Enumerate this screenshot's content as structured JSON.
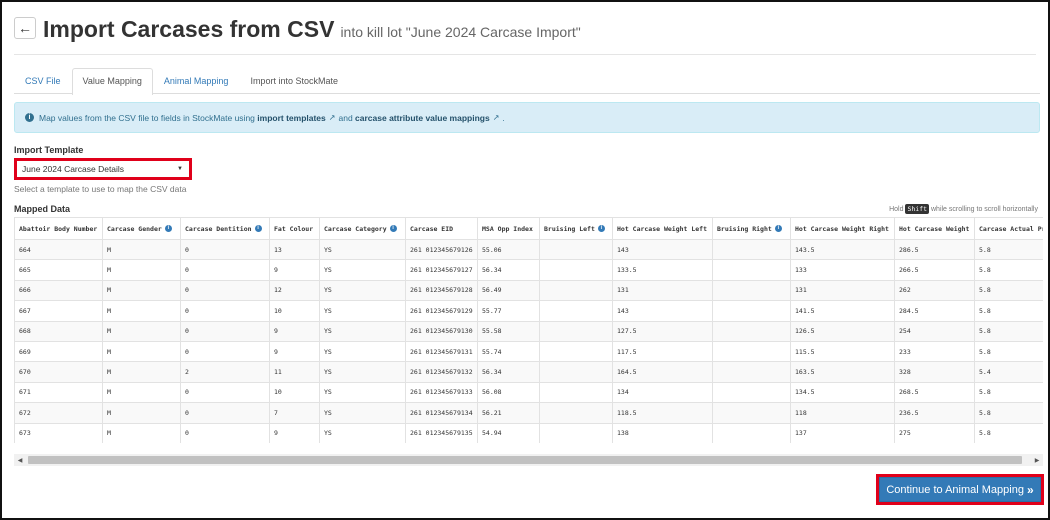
{
  "header": {
    "back_glyph": "←",
    "title": "Import Carcases from CSV",
    "subtitle": "into kill lot \"June 2024 Carcase Import\""
  },
  "tabs": [
    {
      "label": "CSV File",
      "state": "link"
    },
    {
      "label": "Value Mapping",
      "state": "active"
    },
    {
      "label": "Animal Mapping",
      "state": "link"
    },
    {
      "label": "Import into StockMate",
      "state": "plain"
    }
  ],
  "alert": {
    "prefix": "Map values from the CSV file to fields in StockMate using",
    "link1": "import templates",
    "middle": "and",
    "link2": "carcase attribute value mappings",
    "suffix": "."
  },
  "import_template": {
    "label": "Import Template",
    "selected": "June 2024 Carcase Details",
    "help": "Select a template to use to map the CSV data"
  },
  "mapped_data": {
    "label": "Mapped Data",
    "hint_prefix": "Hold",
    "hint_key": "Shift",
    "hint_suffix": "while scrolling to scroll horizontally"
  },
  "table": {
    "columns": [
      {
        "label": "Abattoir Body Number",
        "info": false
      },
      {
        "label": "Carcase Gender",
        "info": true
      },
      {
        "label": "Carcase Dentition",
        "info": true
      },
      {
        "label": "Fat Colour",
        "info": false
      },
      {
        "label": "Carcase Category",
        "info": true
      },
      {
        "label": "Carcase EID",
        "info": false
      },
      {
        "label": "MSA Opp Index",
        "info": false
      },
      {
        "label": "Bruising Left",
        "info": true
      },
      {
        "label": "Hot Carcase Weight Left",
        "info": false
      },
      {
        "label": "Bruising Right",
        "info": true
      },
      {
        "label": "Hot Carcase Weight Right",
        "info": false
      },
      {
        "label": "Hot Carcase Weight",
        "info": false
      },
      {
        "label": "Carcase Actual Pr",
        "info": false
      }
    ],
    "rows": [
      [
        "664",
        "M",
        "0",
        "13",
        "YS",
        "261 012345679126",
        "55.06",
        "",
        "143",
        "",
        "143.5",
        "286.5",
        "5.8"
      ],
      [
        "665",
        "M",
        "0",
        "9",
        "YS",
        "261 012345679127",
        "56.34",
        "",
        "133.5",
        "",
        "133",
        "266.5",
        "5.8"
      ],
      [
        "666",
        "M",
        "0",
        "12",
        "YS",
        "261 012345679128",
        "56.49",
        "",
        "131",
        "",
        "131",
        "262",
        "5.8"
      ],
      [
        "667",
        "M",
        "0",
        "10",
        "YS",
        "261 012345679129",
        "55.77",
        "",
        "143",
        "",
        "141.5",
        "284.5",
        "5.8"
      ],
      [
        "668",
        "M",
        "0",
        "9",
        "YS",
        "261 012345679130",
        "55.58",
        "",
        "127.5",
        "",
        "126.5",
        "254",
        "5.8"
      ],
      [
        "669",
        "M",
        "0",
        "9",
        "YS",
        "261 012345679131",
        "55.74",
        "",
        "117.5",
        "",
        "115.5",
        "233",
        "5.8"
      ],
      [
        "670",
        "M",
        "2",
        "11",
        "YS",
        "261 012345679132",
        "56.34",
        "",
        "164.5",
        "",
        "163.5",
        "328",
        "5.4"
      ],
      [
        "671",
        "M",
        "0",
        "10",
        "YS",
        "261 012345679133",
        "56.08",
        "",
        "134",
        "",
        "134.5",
        "268.5",
        "5.8"
      ],
      [
        "672",
        "M",
        "0",
        "7",
        "YS",
        "261 012345679134",
        "56.21",
        "",
        "118.5",
        "",
        "118",
        "236.5",
        "5.8"
      ],
      [
        "673",
        "M",
        "0",
        "9",
        "YS",
        "261 012345679135",
        "54.94",
        "",
        "138",
        "",
        "137",
        "275",
        "5.8"
      ]
    ]
  },
  "continue_button": {
    "label": "Continue to Animal Mapping",
    "glyph": "»"
  },
  "colors": {
    "primary": "#337ab7",
    "alert_bg": "#d9edf7",
    "highlight": "#e0001a"
  }
}
